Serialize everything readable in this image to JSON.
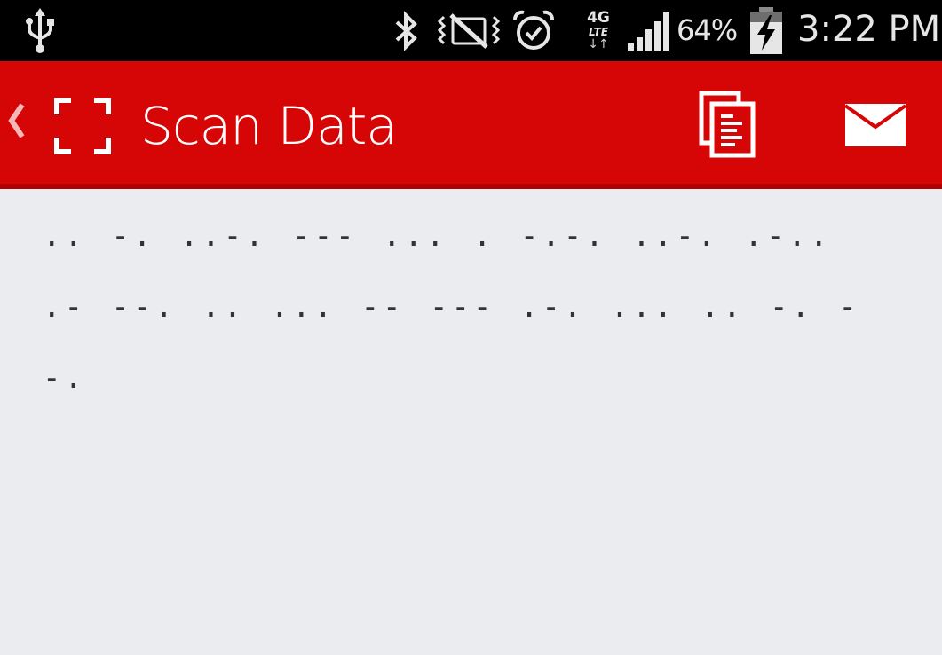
{
  "status_bar": {
    "usb_icon": "usb-icon",
    "bluetooth_icon": "bluetooth-icon",
    "vibrate_icon": "vibrate-mute-icon",
    "alarm_icon": "alarm-clock-icon",
    "network_label_top": "4G",
    "network_label_bottom": "LTE",
    "signal_icon": "signal-strength-icon",
    "battery_percent": "64%",
    "battery_icon": "battery-charging-icon",
    "time": "3:22 PM"
  },
  "action_bar": {
    "background_color": "#d60606",
    "back_icon": "chevron-left-icon",
    "app_icon": "scan-frame-icon",
    "title": "Scan Data",
    "copy_icon": "copy-clipboard-icon",
    "email_icon": "envelope-icon"
  },
  "content": {
    "scan_text": ".. -. ..-. --- ... . -.-. ..-. .-.. .- --. .. ... -- --- .-. ... .. -. --."
  }
}
